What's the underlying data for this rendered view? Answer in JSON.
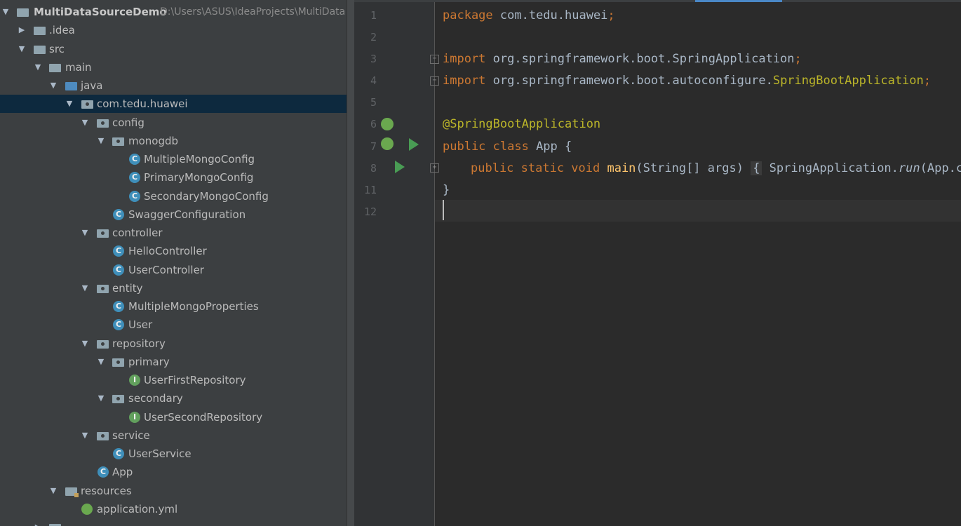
{
  "project": {
    "root": {
      "name": "MultiDataSourceDemo",
      "path": "D:\\Users\\ASUS\\IdeaProjects\\MultiData"
    },
    "items": [
      {
        "label": ".idea"
      },
      {
        "label": "src"
      },
      {
        "label": "main"
      },
      {
        "label": "java"
      },
      {
        "label": "com.tedu.huawei"
      },
      {
        "label": "config"
      },
      {
        "label": "monogdb"
      },
      {
        "label": "MultipleMongoConfig"
      },
      {
        "label": "PrimaryMongoConfig"
      },
      {
        "label": "SecondaryMongoConfig"
      },
      {
        "label": "SwaggerConfiguration"
      },
      {
        "label": "controller"
      },
      {
        "label": "HelloController"
      },
      {
        "label": "UserController"
      },
      {
        "label": "entity"
      },
      {
        "label": "MultipleMongoProperties"
      },
      {
        "label": "User"
      },
      {
        "label": "repository"
      },
      {
        "label": "primary"
      },
      {
        "label": "UserFirstRepository"
      },
      {
        "label": "secondary"
      },
      {
        "label": "UserSecondRepository"
      },
      {
        "label": "service"
      },
      {
        "label": "UserService"
      },
      {
        "label": "App"
      },
      {
        "label": "resources"
      },
      {
        "label": "application.yml"
      }
    ],
    "icon_letters": {
      "class": "C",
      "interface": "I"
    }
  },
  "editor": {
    "line_numbers": [
      "1",
      "2",
      "3",
      "4",
      "5",
      "6",
      "7",
      "8",
      "11",
      "12"
    ],
    "code": {
      "l1_kw": "package",
      "l1_rest": " com.tedu.huawei",
      "l1_semi": ";",
      "l3_kw": "import",
      "l3_rest": " org.springframework.boot.SpringApplication",
      "l3_semi": ";",
      "l4_kw": "import",
      "l4_rest": " org.springframework.boot.autoconfigure.",
      "l4_cls": "SpringBootApplication",
      "l4_semi": ";",
      "l6_ann": "@SpringBootApplication",
      "l7_kw": "public class",
      "l7_rest": " App {",
      "l8_kw": "public static void",
      "l8_fn": " main",
      "l8_rest": "(String[] args) ",
      "l8_fold": "{",
      "l8_tail_a": " SpringApplication.",
      "l8_tail_run": "run",
      "l8_tail_b": "(App.cla",
      "l11": "}"
    }
  },
  "colors": {
    "keyword": "#cc7832",
    "annotation": "#bbb529",
    "method": "#ffc66d",
    "plain": "#a9b7c6",
    "selection": "#0d293e"
  }
}
